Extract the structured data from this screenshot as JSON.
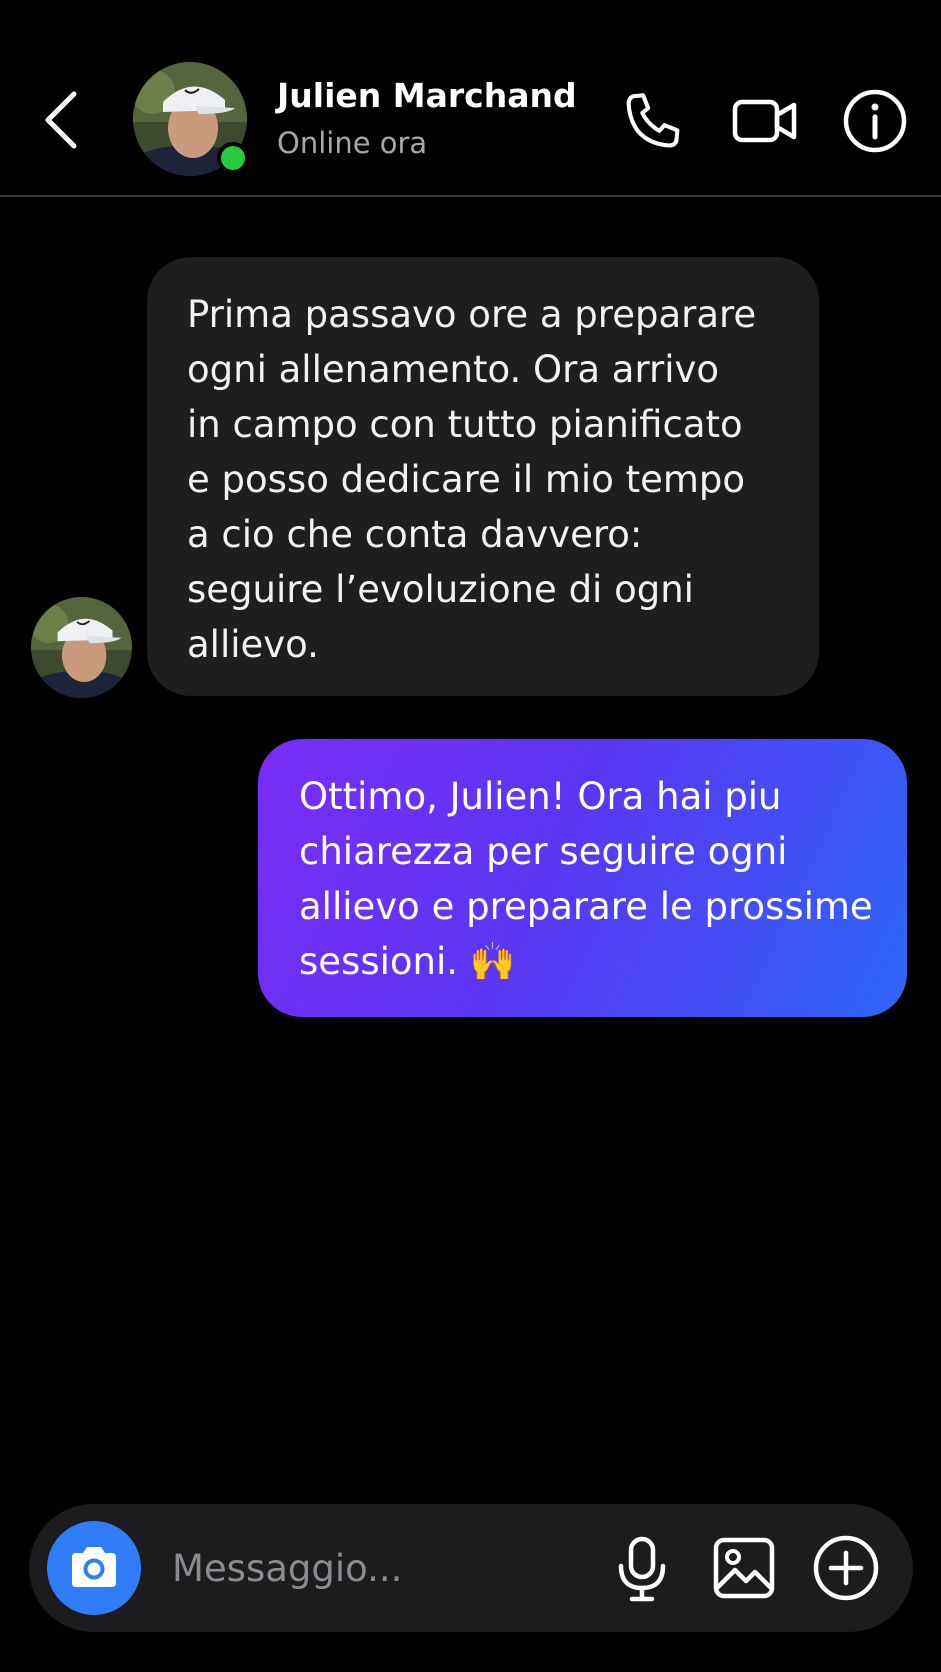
{
  "header": {
    "contact_name": "Julien Marchand",
    "status": "Online ora",
    "online": true,
    "icons": [
      "chevron-left-icon",
      "phone-icon",
      "video-camera-icon",
      "info-icon"
    ]
  },
  "messages": [
    {
      "direction": "incoming",
      "lines": [
        "Prima passavo ore a preparare",
        "ogni allenamento. Ora arrivo",
        "in campo con tutto pianificato",
        "e posso dedicare il mio tempo",
        "a cio che conta davvero:",
        "seguire l’evoluzione di ogni",
        "allievo."
      ]
    },
    {
      "direction": "outgoing",
      "lines": [
        "Ottimo, Julien! Ora hai piu",
        "chiarezza per seguire ogni",
        "allievo e preparare le prossime",
        "sessioni. 🙌"
      ]
    }
  ],
  "composer": {
    "placeholder": "Messaggio...",
    "value": "",
    "icons": [
      "camera-icon",
      "microphone-icon",
      "image-icon",
      "plus-icon"
    ]
  },
  "colors": {
    "background": "#000000",
    "incoming_bubble": "#1e1e20",
    "outgoing_gradient_start": "#7a2cf6",
    "outgoing_gradient_end": "#2d66f5",
    "online_dot": "#27c93f",
    "camera_button": "#2f7cf6",
    "status_text": "#a6a6ab"
  }
}
